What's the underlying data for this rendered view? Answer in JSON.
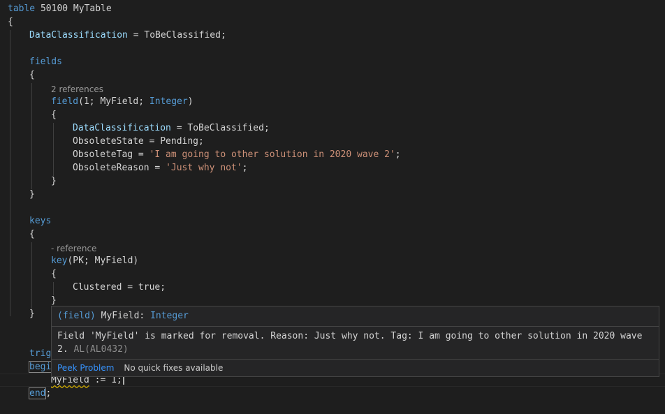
{
  "code": {
    "l1_kw": "table",
    "l1_rest": " 50100 MyTable",
    "brace_open": "{",
    "brace_close": "}",
    "dataclassification_prop": "DataClassification",
    "dataclassification_val": " = ToBeClassified;",
    "fields_kw": "fields",
    "field_lens": "2 references",
    "field_kw": "field",
    "field_args": "(1; MyField; ",
    "field_type": "Integer",
    "field_close": ")",
    "obsolete_state": "ObsoleteState = Pending;",
    "obsolete_tag_name": "ObsoleteTag = ",
    "obsolete_tag_val": "'I am going to other solution in 2020 wave 2'",
    "obsolete_reason_name": "ObsoleteReason = ",
    "obsolete_reason_val": "'Just why not'",
    "semicolon": ";",
    "keys_kw": "keys",
    "key_lens": "- reference",
    "key_kw": "key",
    "key_args": "(PK; MyField)",
    "clustered": "Clustered = true;",
    "trigger_partial": "trig",
    "begin_partial": "begi",
    "assign_target": "MyField",
    "assign_op": " := ",
    "assign_val": "1;",
    "end_kw": "end",
    "end_semicolon": ";"
  },
  "hover": {
    "sig_prefix": "(field) ",
    "sig_name": "MyField: ",
    "sig_type": "Integer",
    "message": "Field 'MyField' is marked for removal. Reason: Just why not. Tag: I am going to other solution in 2020 wave 2.",
    "code": "AL(AL0432)",
    "peek_label": "Peek Problem",
    "no_fix_label": "No quick fixes available"
  },
  "colors": {
    "background": "#1e1e1e",
    "keyword": "#569cd6",
    "property": "#9cdcfe",
    "string": "#ce9178",
    "warning_squiggle": "#cca700",
    "link": "#3794ff"
  }
}
